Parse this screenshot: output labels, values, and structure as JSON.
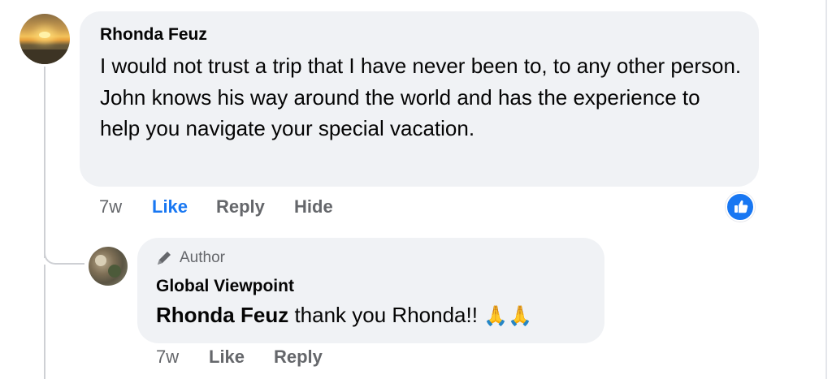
{
  "comment": {
    "author": "Rhonda Feuz",
    "text": "I would not trust a trip that I have never been to, to any other person. John knows his way around the world and has the experience to help you navigate your special vacation.",
    "time": "7w",
    "like_label": "Like",
    "reply_label": "Reply",
    "hide_label": "Hide",
    "reaction_icon": "like-icon",
    "avatar_icon": "sunset-avatar"
  },
  "reply": {
    "badge": "Author",
    "badge_icon": "pen-icon",
    "author": "Global Viewpoint",
    "mention": "Rhonda Feuz",
    "text": " thank you Rhonda!! ",
    "emoji": "🙏🙏",
    "time": "7w",
    "like_label": "Like",
    "reply_label": "Reply",
    "avatar_icon": "profile-avatar"
  },
  "colors": {
    "link_blue": "#1877f2",
    "bubble_bg": "#f0f2f5",
    "meta_gray": "#65676b"
  }
}
